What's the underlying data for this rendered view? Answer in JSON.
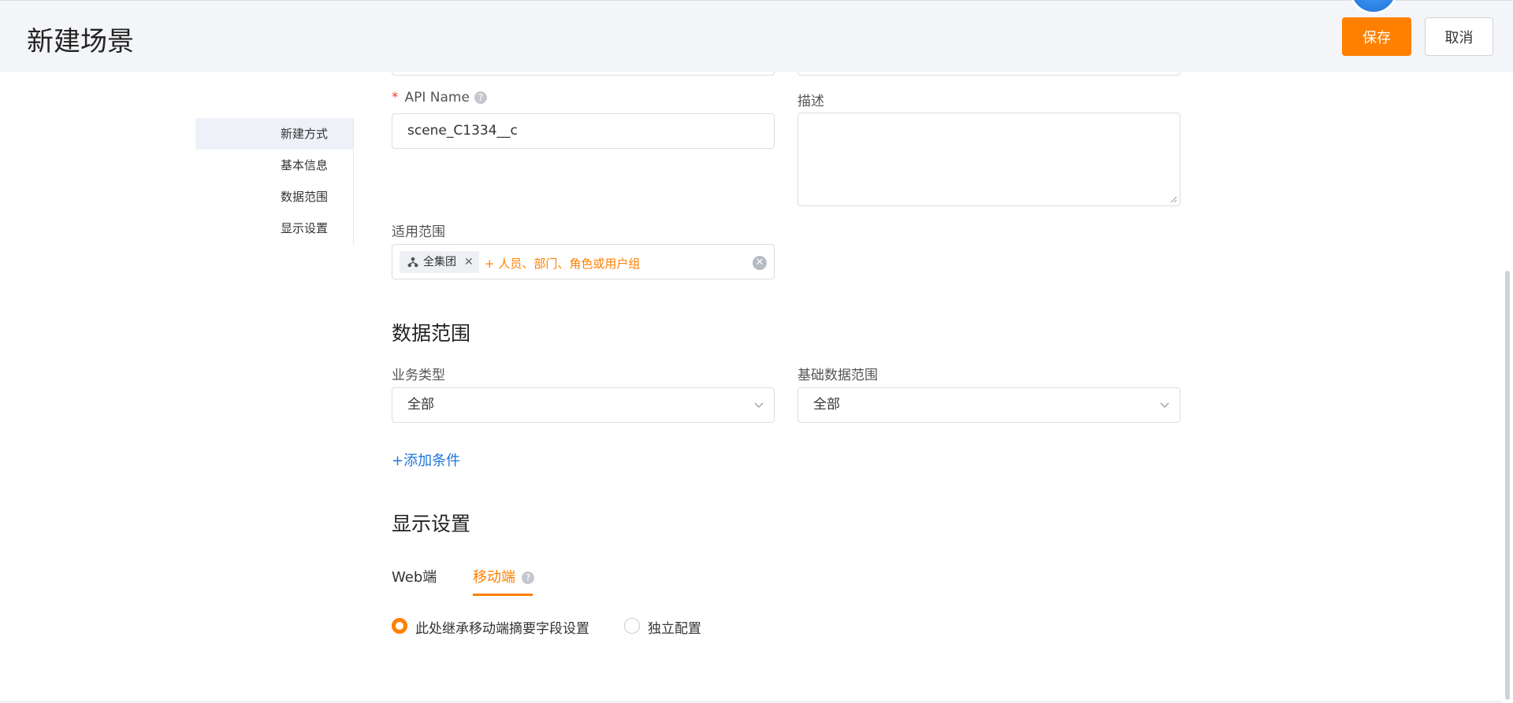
{
  "header": {
    "title": "新建场景",
    "save_label": "保存",
    "cancel_label": "取消"
  },
  "anchor_nav": {
    "items": [
      {
        "label": "新建方式",
        "active": true
      },
      {
        "label": "基本信息",
        "active": false
      },
      {
        "label": "数据范围",
        "active": false
      },
      {
        "label": "显示设置",
        "active": false
      }
    ]
  },
  "basic_info": {
    "api_name_label": "API Name",
    "api_name_value": "scene_C1334__c",
    "description_label": "描述",
    "description_value": "",
    "scope_label": "适用范围",
    "scope_tag": "全集团",
    "scope_add_label": "+ 人员、部门、角色或用户组"
  },
  "data_range": {
    "section_title": "数据范围",
    "business_type_label": "业务类型",
    "business_type_value": "全部",
    "base_range_label": "基础数据范围",
    "base_range_value": "全部",
    "add_condition_label": "+添加条件"
  },
  "display_settings": {
    "section_title": "显示设置",
    "tabs": [
      {
        "label": "Web端",
        "active": false
      },
      {
        "label": "移动端",
        "active": true
      }
    ],
    "options": [
      {
        "label": "此处继承移动端摘要字段设置",
        "checked": true
      },
      {
        "label": "独立配置",
        "checked": false
      }
    ]
  },
  "colors": {
    "accent": "#ff8000",
    "link": "#1f75d8",
    "header_bg": "#f3f5f8",
    "active_nav_bg": "#eef1f7"
  }
}
